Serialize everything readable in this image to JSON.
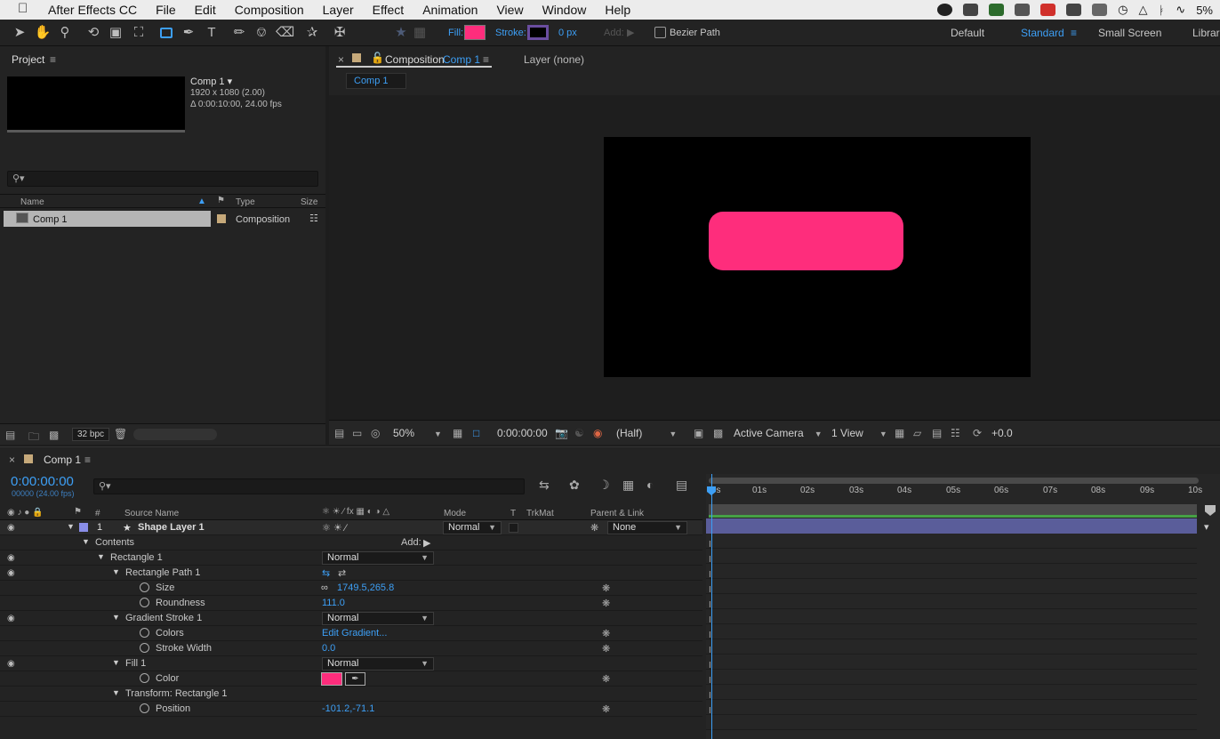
{
  "menubar": {
    "items": [
      "After Effects CC",
      "File",
      "Edit",
      "Composition",
      "Layer",
      "Effect",
      "Animation",
      "View",
      "Window",
      "Help"
    ],
    "battery": "5%"
  },
  "toolbar": {
    "fill_label": "Fill:",
    "stroke_label": "Stroke:",
    "stroke_width": "0 px",
    "add_label": "Add:",
    "bezier_label": "Bezier Path",
    "fill_color": "#fe2d7c",
    "workspaces": [
      "Default",
      "Standard",
      "Small Screen",
      "Librari"
    ]
  },
  "project": {
    "tab": "Project",
    "comp_name": "Comp 1 ▾",
    "comp_dims": "1920 x 1080 (2.00)",
    "comp_duration": "Δ 0:00:10:00, 24.00 fps",
    "columns": [
      "Name",
      "Type",
      "Size"
    ],
    "items": [
      {
        "name": "Comp 1",
        "type": "Composition"
      }
    ],
    "bpc": "32 bpc"
  },
  "viewer": {
    "tab_prefix": "Composition",
    "tab_comp": "Comp 1",
    "layer_tab": "Layer (none)",
    "breadcrumb": "Comp 1",
    "zoom": "50%",
    "timecode": "0:00:00:00",
    "resolution": "(Half)",
    "camera": "Active Camera",
    "views": "1 View",
    "exposure": "+0.0",
    "shape_color": "#fe2d7c"
  },
  "timeline": {
    "tab": "Comp 1",
    "timecode": "0:00:00:00",
    "timecode_sub": "00000 (24.00 fps)",
    "headers": {
      "num": "#",
      "source": "Source Name",
      "mode": "Mode",
      "t": "T",
      "trkmat": "TrkMat",
      "parent": "Parent & Link"
    },
    "layer": {
      "num": "1",
      "name": "Shape Layer 1",
      "mode": "Normal",
      "parent": "None"
    },
    "contents_label": "Contents",
    "add_label": "Add:",
    "props": {
      "rect1": "Rectangle 1",
      "rect1_mode": "Normal",
      "rectpath": "Rectangle Path 1",
      "size": "Size",
      "size_val": "1749.5,265.8",
      "roundness": "Roundness",
      "roundness_val": "111.0",
      "gstroke": "Gradient Stroke 1",
      "gstroke_mode": "Normal",
      "colors": "Colors",
      "colors_val": "Edit Gradient...",
      "stroke_width": "Stroke Width",
      "stroke_width_val": "0.0",
      "fill": "Fill 1",
      "fill_mode": "Normal",
      "color": "Color",
      "transform": "Transform: Rectangle 1",
      "position": "Position",
      "position_val": "-101.2,-71.1"
    },
    "ticks": [
      "0s",
      "01s",
      "02s",
      "03s",
      "04s",
      "05s",
      "06s",
      "07s",
      "08s",
      "09s",
      "10s"
    ]
  }
}
